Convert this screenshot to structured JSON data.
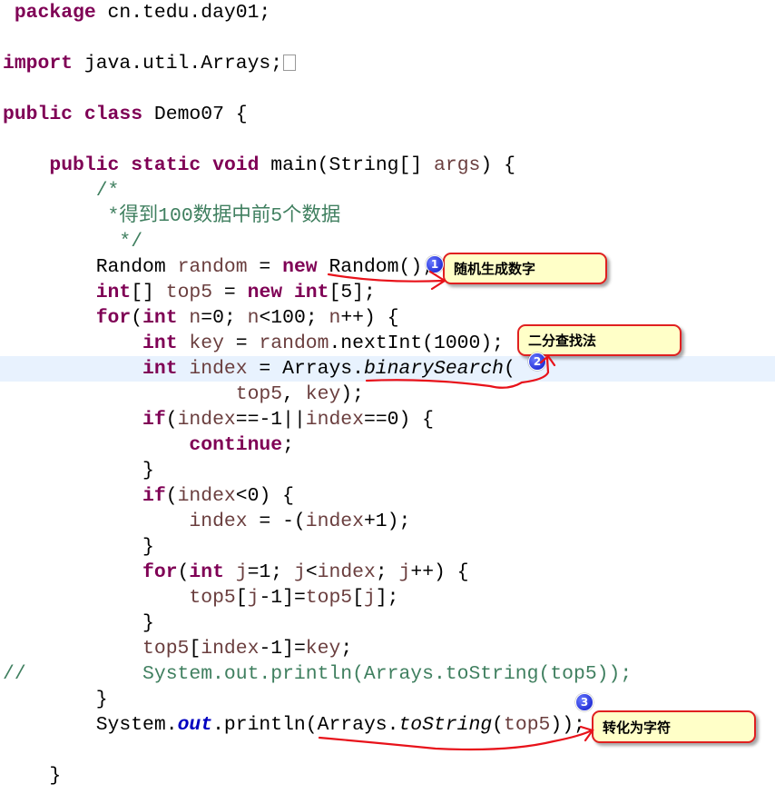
{
  "editor": {
    "highlight_line": 15,
    "lines": [
      [
        [
          "p",
          " "
        ],
        [
          "k",
          "package"
        ],
        [
          "p",
          " cn.tedu.day01;"
        ]
      ],
      [],
      [
        [
          "k",
          "import"
        ],
        [
          "p",
          " java.util.Arrays;"
        ]
      ],
      [],
      [
        [
          "k",
          "public"
        ],
        [
          "p",
          " "
        ],
        [
          "k",
          "class"
        ],
        [
          "p",
          " Demo07 {"
        ]
      ],
      [],
      [
        [
          "p",
          "    "
        ],
        [
          "k",
          "public"
        ],
        [
          "p",
          " "
        ],
        [
          "k",
          "static"
        ],
        [
          "p",
          " "
        ],
        [
          "k",
          "void"
        ],
        [
          "p",
          " main(String[] "
        ],
        [
          "v",
          "args"
        ],
        [
          "p",
          ") {"
        ]
      ],
      [
        [
          "c",
          "        /*"
        ]
      ],
      [
        [
          "c",
          "         *得到100数据中前5个数据"
        ]
      ],
      [
        [
          "c",
          "          */"
        ]
      ],
      [
        [
          "p",
          "        Random "
        ],
        [
          "v",
          "random"
        ],
        [
          "p",
          " = "
        ],
        [
          "k",
          "new"
        ],
        [
          "p",
          " Random();"
        ]
      ],
      [
        [
          "p",
          "        "
        ],
        [
          "k",
          "int"
        ],
        [
          "p",
          "[] "
        ],
        [
          "v",
          "top5"
        ],
        [
          "p",
          " = "
        ],
        [
          "k",
          "new"
        ],
        [
          "p",
          " "
        ],
        [
          "k",
          "int"
        ],
        [
          "p",
          "[5];"
        ]
      ],
      [
        [
          "p",
          "        "
        ],
        [
          "k",
          "for"
        ],
        [
          "p",
          "("
        ],
        [
          "k",
          "int"
        ],
        [
          "p",
          " "
        ],
        [
          "v",
          "n"
        ],
        [
          "p",
          "=0; "
        ],
        [
          "v",
          "n"
        ],
        [
          "p",
          "<100; "
        ],
        [
          "v",
          "n"
        ],
        [
          "p",
          "++) {"
        ]
      ],
      [
        [
          "p",
          "            "
        ],
        [
          "k",
          "int"
        ],
        [
          "p",
          " "
        ],
        [
          "v",
          "key"
        ],
        [
          "p",
          " = "
        ],
        [
          "v",
          "random"
        ],
        [
          "p",
          ".nextInt(1000);"
        ]
      ],
      [
        [
          "p",
          "            "
        ],
        [
          "k",
          "int"
        ],
        [
          "p",
          " "
        ],
        [
          "v",
          "index"
        ],
        [
          "p",
          " = Arrays."
        ],
        [
          "s",
          "binarySearch"
        ],
        [
          "p",
          "("
        ]
      ],
      [
        [
          "p",
          "                    "
        ],
        [
          "v",
          "top5"
        ],
        [
          "p",
          ", "
        ],
        [
          "v",
          "key"
        ],
        [
          "p",
          ");"
        ]
      ],
      [
        [
          "p",
          "            "
        ],
        [
          "k",
          "if"
        ],
        [
          "p",
          "("
        ],
        [
          "v",
          "index"
        ],
        [
          "p",
          "==-1||"
        ],
        [
          "v",
          "index"
        ],
        [
          "p",
          "==0) {"
        ]
      ],
      [
        [
          "p",
          "                "
        ],
        [
          "k",
          "continue"
        ],
        [
          "p",
          ";"
        ]
      ],
      [
        [
          "p",
          "            }"
        ]
      ],
      [
        [
          "p",
          "            "
        ],
        [
          "k",
          "if"
        ],
        [
          "p",
          "("
        ],
        [
          "v",
          "index"
        ],
        [
          "p",
          "<0) {"
        ]
      ],
      [
        [
          "p",
          "                "
        ],
        [
          "v",
          "index"
        ],
        [
          "p",
          " = -("
        ],
        [
          "v",
          "index"
        ],
        [
          "p",
          "+1);"
        ]
      ],
      [
        [
          "p",
          "            }"
        ]
      ],
      [
        [
          "p",
          "            "
        ],
        [
          "k",
          "for"
        ],
        [
          "p",
          "("
        ],
        [
          "k",
          "int"
        ],
        [
          "p",
          " "
        ],
        [
          "v",
          "j"
        ],
        [
          "p",
          "=1; "
        ],
        [
          "v",
          "j"
        ],
        [
          "p",
          "<"
        ],
        [
          "v",
          "index"
        ],
        [
          "p",
          "; "
        ],
        [
          "v",
          "j"
        ],
        [
          "p",
          "++) {"
        ]
      ],
      [
        [
          "p",
          "                "
        ],
        [
          "v",
          "top5"
        ],
        [
          "p",
          "["
        ],
        [
          "v",
          "j"
        ],
        [
          "p",
          "-1]="
        ],
        [
          "v",
          "top5"
        ],
        [
          "p",
          "["
        ],
        [
          "v",
          "j"
        ],
        [
          "p",
          "];"
        ]
      ],
      [
        [
          "p",
          "            }"
        ]
      ],
      [
        [
          "p",
          "            "
        ],
        [
          "v",
          "top5"
        ],
        [
          "p",
          "["
        ],
        [
          "v",
          "index"
        ],
        [
          "p",
          "-1]="
        ],
        [
          "v",
          "key"
        ],
        [
          "p",
          ";"
        ]
      ],
      [
        [
          "c",
          "//          System.out.println(Arrays.toString(top5));"
        ]
      ],
      [
        [
          "p",
          "        }"
        ]
      ],
      [
        [
          "p",
          "        System."
        ],
        [
          "f",
          "out"
        ],
        [
          "p",
          ".println(Arrays."
        ],
        [
          "s",
          "toString"
        ],
        [
          "p",
          "("
        ],
        [
          "v",
          "top5"
        ],
        [
          "p",
          "));"
        ]
      ],
      [],
      [
        [
          "p",
          "    }"
        ]
      ]
    ]
  },
  "annotations": [
    {
      "number": "1",
      "text": "随机生成数字"
    },
    {
      "number": "2",
      "text": "二分查找法"
    },
    {
      "number": "3",
      "text": "转化为字符"
    }
  ],
  "colors": {
    "keyword": "#7f0055",
    "comment": "#3f7f5f",
    "variable": "#6a3e3e",
    "field": "#0000c0",
    "current_line": "#e8f2fe",
    "annotation_stroke": "#e02020",
    "annotation_fill": "#ffffc8"
  }
}
